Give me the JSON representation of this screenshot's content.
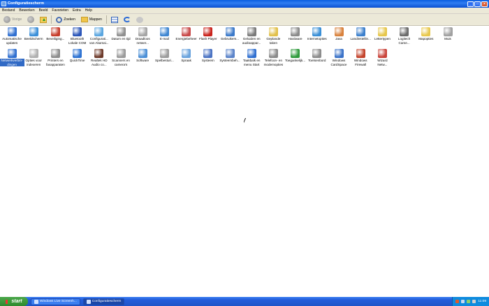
{
  "window": {
    "title": "Configuratiescherm",
    "buttons": {
      "minimize": "_",
      "maximize": "□",
      "close": "×"
    }
  },
  "menu": [
    "Bestand",
    "Bewerken",
    "Beeld",
    "Favorieten",
    "Extra",
    "Help"
  ],
  "toolbar": {
    "back_label": "Vorige",
    "search_label": "Zoeken",
    "folders_label": "Mappen"
  },
  "items": [
    {
      "label": "Automatische\nupdates",
      "color": "#2f6fd0"
    },
    {
      "label": "Beeldscherm",
      "color": "#3b8fd8"
    },
    {
      "label": "Beveiliging...",
      "color": "#c63c2a"
    },
    {
      "label": "Bluetooth\nLokale COM",
      "color": "#2a55b8"
    },
    {
      "label": "Configurati...\nvan Akamai...",
      "color": "#5aa6e0"
    },
    {
      "label": "Datum en tijd",
      "color": "#8f8f8f"
    },
    {
      "label": "Draadloos\nnetwer...",
      "color": "#a5a5a5"
    },
    {
      "label": "E-mail",
      "color": "#3f86d1"
    },
    {
      "label": "Energiebeheer",
      "color": "#c84a4a"
    },
    {
      "label": "Flash Player",
      "color": "#c9231c"
    },
    {
      "label": "Gebruikers...",
      "color": "#3b79c9"
    },
    {
      "label": "Geluiden en\naudioappar...",
      "color": "#7a7a7a"
    },
    {
      "label": "Geplande\ntaken",
      "color": "#e1c04a"
    },
    {
      "label": "Hardware",
      "color": "#8a8a8a"
    },
    {
      "label": "Internetopties",
      "color": "#3a8fd6"
    },
    {
      "label": "Java",
      "color": "#d8813c"
    },
    {
      "label": "Landinstellin...",
      "color": "#3b7fcc"
    },
    {
      "label": "Lettertypen",
      "color": "#e6c64a"
    },
    {
      "label": "Logitech\nCame...",
      "color": "#6b6b6b"
    },
    {
      "label": "Mapopties",
      "color": "#e8c84d"
    },
    {
      "label": "Muis",
      "color": "#a0a0a0"
    },
    {
      "label": "Netwerkverbin-\ndingen",
      "color": "#2f6fd0",
      "selected": true
    },
    {
      "label": "Opties voor\nindexeren",
      "color": "#b0b0b0"
    },
    {
      "label": "Printers en\nfaxapparaten",
      "color": "#8d8d8d"
    },
    {
      "label": "QuickTime",
      "color": "#2d72d2"
    },
    {
      "label": "Realtek HD\nAudio co...",
      "color": "#6d3a2a"
    },
    {
      "label": "Scanners en\ncamera's",
      "color": "#9a9a9a"
    },
    {
      "label": "Software",
      "color": "#4b8fd6"
    },
    {
      "label": "Spelbesturi...",
      "color": "#9c9c9c"
    },
    {
      "label": "Spraak",
      "color": "#6aa3dd"
    },
    {
      "label": "Systeem",
      "color": "#4b73c3"
    },
    {
      "label": "Systeembeh...",
      "color": "#5a83c9"
    },
    {
      "label": "Taakbalk en\nmenu Start",
      "color": "#2f6fd0"
    },
    {
      "label": "Telefoon- en\nmodemopties",
      "color": "#8a8a8a"
    },
    {
      "label": "Toegankelijk...",
      "color": "#2f9a3c"
    },
    {
      "label": "Toetsenbord",
      "color": "#8c8c8c"
    },
    {
      "label": "Windows\nCardSpace",
      "color": "#3a72c8"
    },
    {
      "label": "Windows\nFirewall",
      "color": "#c3432b"
    },
    {
      "label": "Wizard\nNetw...",
      "color": "#c9433a"
    }
  ],
  "taskbar": {
    "start_label": "start",
    "tasks": [
      {
        "label": "Windows Live Screenh...",
        "active": false
      },
      {
        "label": "Configuratiescherm",
        "active": true
      }
    ],
    "clock": "11:09"
  }
}
